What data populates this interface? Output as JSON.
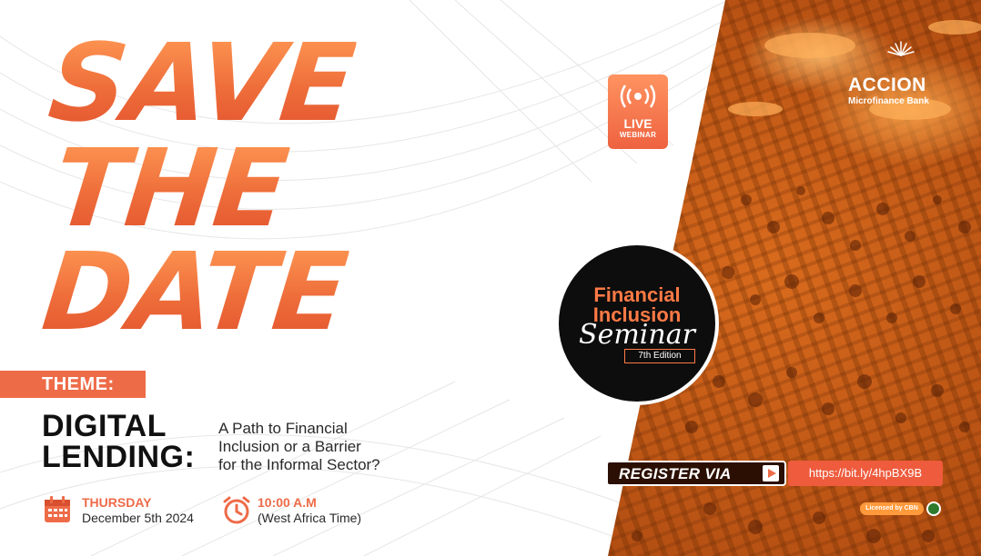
{
  "headline": {
    "line1": "SAVE",
    "line2": "THE",
    "line3": "DATE"
  },
  "theme": {
    "badge_label": "THEME:",
    "title_line1": "DIGITAL",
    "title_line2": "LENDING:",
    "subtitle_line1": "A Path to Financial",
    "subtitle_line2": "Inclusion or a Barrier",
    "subtitle_line3": "for the Informal Sector?"
  },
  "schedule": {
    "day": "THURSDAY",
    "date": "December 5th 2024",
    "time": "10:00 A.M",
    "timezone": "(West Africa Time)"
  },
  "live_badge": {
    "line1": "LIVE",
    "line2": "WEBINAR",
    "icon": "broadcast-icon"
  },
  "brand": {
    "name": "ACCION",
    "subtitle": "Microfinance Bank",
    "icon": "sunburst-logo-icon"
  },
  "seminar": {
    "line1": "Financial",
    "line2": "Inclusion",
    "script": "Seminar",
    "edition": "7th Edition"
  },
  "register": {
    "label": "REGISTER VIA",
    "url": "https://bit.ly/4hpBX9B"
  },
  "license": {
    "label": "Licensed by CBN"
  },
  "colors": {
    "accent": "#ee6b48",
    "accent_light": "#ff9a55",
    "dark": "#111111"
  }
}
